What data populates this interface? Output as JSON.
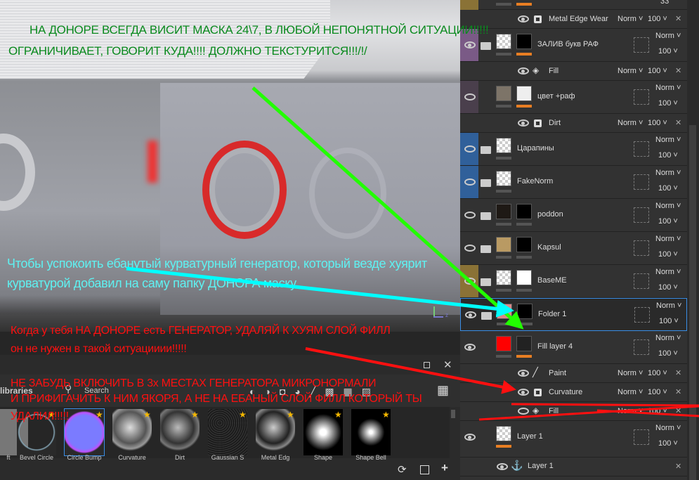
{
  "annotations": {
    "green_line1": "НА ДОНОРЕ ВСЕГДА ВИСИТ МАСКА 24\\7, В ЛЮБОЙ НЕПОНЯТНОЙ СИТУАЦИИ!!!!!",
    "green_line2": "ОГРАНИЧИВАЕТ, ГОВОРИТ КУДА!!!! ДОЛЖНО ТЕКСТУРИТСЯ!!!/!/",
    "cyan_line1": "Чтобы успокоить ебанутый курватурный генератор, который везде хуярит",
    "cyan_line2": "курватурой добавил на саму папку ДОНОРА маску",
    "red1_line1": "Когда у тебя НА ДОНОРЕ есть ГЕНЕРАТОР, УДАЛЯЙ К ХУЯМ СЛОЙ ФИЛЛ",
    "red1_line2": "он не нужен в такой ситуацииии!!!!!",
    "red2_line1": "НЕ ЗАБУДЬ ВКЛЮЧИТЬ В 3х МЕСТАХ ГЕНЕРАТОРА МИКРОНОРМАЛИ",
    "red2_line2": "И ПРИФИГАЧИТЬ К НИМ ЯКОРЯ, А НЕ НА ЕБАНЫЙ СЛОЙ ФИЛЛ КОТОРЫЙ ТЫ",
    "red2_line3": "УДАЛИЛ!!!!!",
    "colors": {
      "green": "#0a8a1e",
      "cyan": "#5ef2f2",
      "red": "#ff1010",
      "green_arrow": "#22ff00",
      "cyan_arrow": "#00ffff"
    }
  },
  "viewport": {
    "axis_label": "z"
  },
  "shelf": {
    "title": "libraries",
    "search_placeholder": "Search",
    "items": [
      {
        "label": "ft"
      },
      {
        "label": "Bevel Circle"
      },
      {
        "label": "Circle Bump"
      },
      {
        "label": "Curvature"
      },
      {
        "label": "Dirt"
      },
      {
        "label": "Gaussian S"
      },
      {
        "label": "Metal Edg"
      },
      {
        "label": "Shape"
      },
      {
        "label": "Shape Bell"
      }
    ]
  },
  "layers": {
    "top_partial_value": "33",
    "rows": [
      {
        "kind": "sub",
        "name": "Metal Edge Wear",
        "icon": "generator",
        "blend": "Norm",
        "opacity": "100",
        "visible": true
      },
      {
        "kind": "layer",
        "name": "ЗАЛИВ букв РАФ",
        "folder": true,
        "color": "#7a5a86",
        "blend": "Norm",
        "opacity": "100",
        "visible": true
      },
      {
        "kind": "sub",
        "name": "Fill",
        "icon": "fill",
        "blend": "Norm",
        "opacity": "100",
        "visible": true
      },
      {
        "kind": "layer",
        "name": "цвет +раф",
        "folder": false,
        "color": "#4a3f4c",
        "blend": "Norm",
        "opacity": "100",
        "visible": false
      },
      {
        "kind": "sub",
        "name": "Dirt",
        "icon": "generator",
        "blend": "Norm",
        "opacity": "100",
        "visible": true
      },
      {
        "kind": "layer",
        "name": "Царапины",
        "folder": true,
        "color": "#30609a",
        "blend": "Norm",
        "opacity": "100",
        "visible": false
      },
      {
        "kind": "layer",
        "name": "FakeNorm",
        "folder": true,
        "color": "#30609a",
        "blend": "Norm",
        "opacity": "100",
        "visible": false
      },
      {
        "kind": "layer",
        "name": "poddon",
        "folder": true,
        "color": "",
        "blend": "Norm",
        "opacity": "100",
        "visible": false
      },
      {
        "kind": "layer",
        "name": "Kapsul",
        "folder": true,
        "color": "",
        "blend": "Norm",
        "opacity": "100",
        "visible": false
      },
      {
        "kind": "layer",
        "name": "BaseME",
        "folder": true,
        "color": "#8a7236",
        "blend": "Norm",
        "opacity": "100",
        "visible": false
      },
      {
        "kind": "layer",
        "name": "Folder 1",
        "folder": true,
        "color": "",
        "blend": "Norm",
        "opacity": "100",
        "visible": true,
        "selected": true
      },
      {
        "kind": "layer",
        "name": "Fill layer 4",
        "folder": false,
        "color": "",
        "blend": "Norm",
        "opacity": "100",
        "visible": true
      },
      {
        "kind": "sub",
        "name": "Paint",
        "icon": "brush",
        "blend": "Norm",
        "opacity": "100",
        "visible": true
      },
      {
        "kind": "sub",
        "name": "Curvature",
        "icon": "generator",
        "blend": "Norm",
        "opacity": "100",
        "visible": true
      },
      {
        "kind": "sub",
        "name": "Fill",
        "icon": "fill",
        "blend": "Norm",
        "opacity": "100",
        "visible": false
      },
      {
        "kind": "layer",
        "name": "Layer 1",
        "folder": false,
        "color": "",
        "blend": "Norm",
        "opacity": "100",
        "visible": true
      },
      {
        "kind": "anchor",
        "name": "Layer 1",
        "visible": true
      }
    ]
  }
}
